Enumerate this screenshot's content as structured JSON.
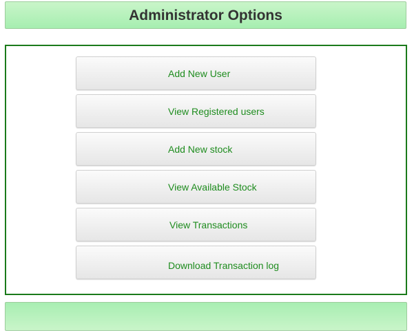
{
  "header": {
    "title": "Administrator Options"
  },
  "menu": {
    "items": [
      {
        "label": "Add New User"
      },
      {
        "label": "View Registered users"
      },
      {
        "label": "Add New stock"
      },
      {
        "label": "View Available Stock"
      },
      {
        "label": "View Transactions"
      },
      {
        "label": "Download Transaction log"
      }
    ]
  },
  "colors": {
    "bar_green": "#a6eeb0",
    "panel_border": "#1a7a1a",
    "button_text": "#1e8c1e",
    "title_text": "#333333"
  }
}
